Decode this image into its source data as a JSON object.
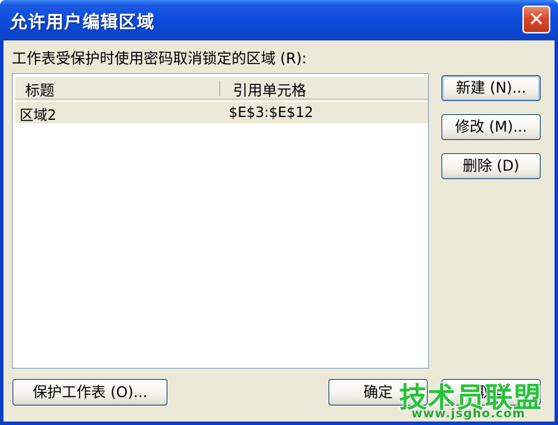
{
  "window": {
    "title": "允许用户编辑区域",
    "close_symbol": "✕"
  },
  "prompt": "工作表受保护时使用密码取消锁定的区域 (R):",
  "list": {
    "columns": [
      "标题",
      "引用单元格"
    ],
    "rows": [
      {
        "title": "区域2",
        "ref": "$E$3:$E$12"
      }
    ]
  },
  "buttons": {
    "new": "新建 (N)...",
    "modify": "修改 (M)...",
    "delete": "删除 (D)",
    "protect_sheet": "保护工作表 (O)...",
    "ok": "确定",
    "cancel": "取消"
  },
  "watermark": {
    "main": "技术员联盟",
    "sub": "www.jsgho.com"
  },
  "colors": {
    "titlebar": "#0a4ad8",
    "client_bg": "#ece9d8",
    "close_button": "#d9472a",
    "watermark": "#27c23a"
  }
}
